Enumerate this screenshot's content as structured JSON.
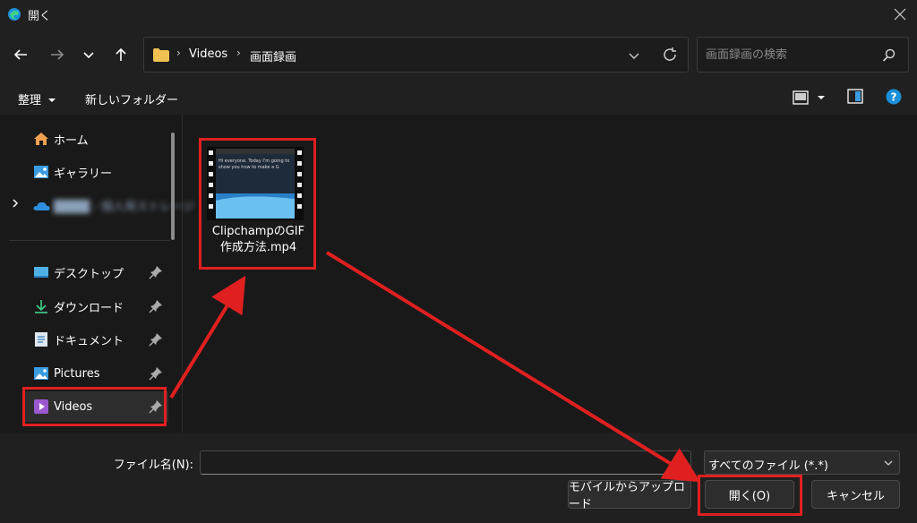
{
  "window": {
    "title": "開く"
  },
  "address": {
    "crumbs": [
      "Videos",
      "画面録画"
    ]
  },
  "search": {
    "placeholder": "画面録画の検索"
  },
  "toolbar": {
    "organize": "整理",
    "new_folder": "新しいフォルダー"
  },
  "sidebar": {
    "items": [
      {
        "label": "ホーム",
        "icon": "home-icon"
      },
      {
        "label": "ギャラリー",
        "icon": "gallery-icon"
      },
      {
        "label": "████ - 個人用ストレージ",
        "icon": "onedrive-icon"
      },
      {
        "label": "デスクトップ",
        "icon": "desktop-icon"
      },
      {
        "label": "ダウンロード",
        "icon": "download-icon"
      },
      {
        "label": "ドキュメント",
        "icon": "document-icon"
      },
      {
        "label": "Pictures",
        "icon": "pictures-icon"
      },
      {
        "label": "Videos",
        "icon": "videos-icon"
      }
    ]
  },
  "files": [
    {
      "name_line1": "ClipchampのGIF",
      "name_line2": "作成方法.mp4",
      "thumb_caption": "Hi everyone. Today I'm going to show you how to make a G"
    }
  ],
  "bottom": {
    "filename_label": "ファイル名(N):",
    "filename_value": "",
    "filetype": "すべてのファイル (*.*)",
    "upload_button": "モバイルからアップロード",
    "open_button": "開く(O)",
    "cancel_button": "キャンセル"
  },
  "colors": {
    "accent": "#e02020",
    "background": "#191919",
    "panel": "#202020"
  }
}
